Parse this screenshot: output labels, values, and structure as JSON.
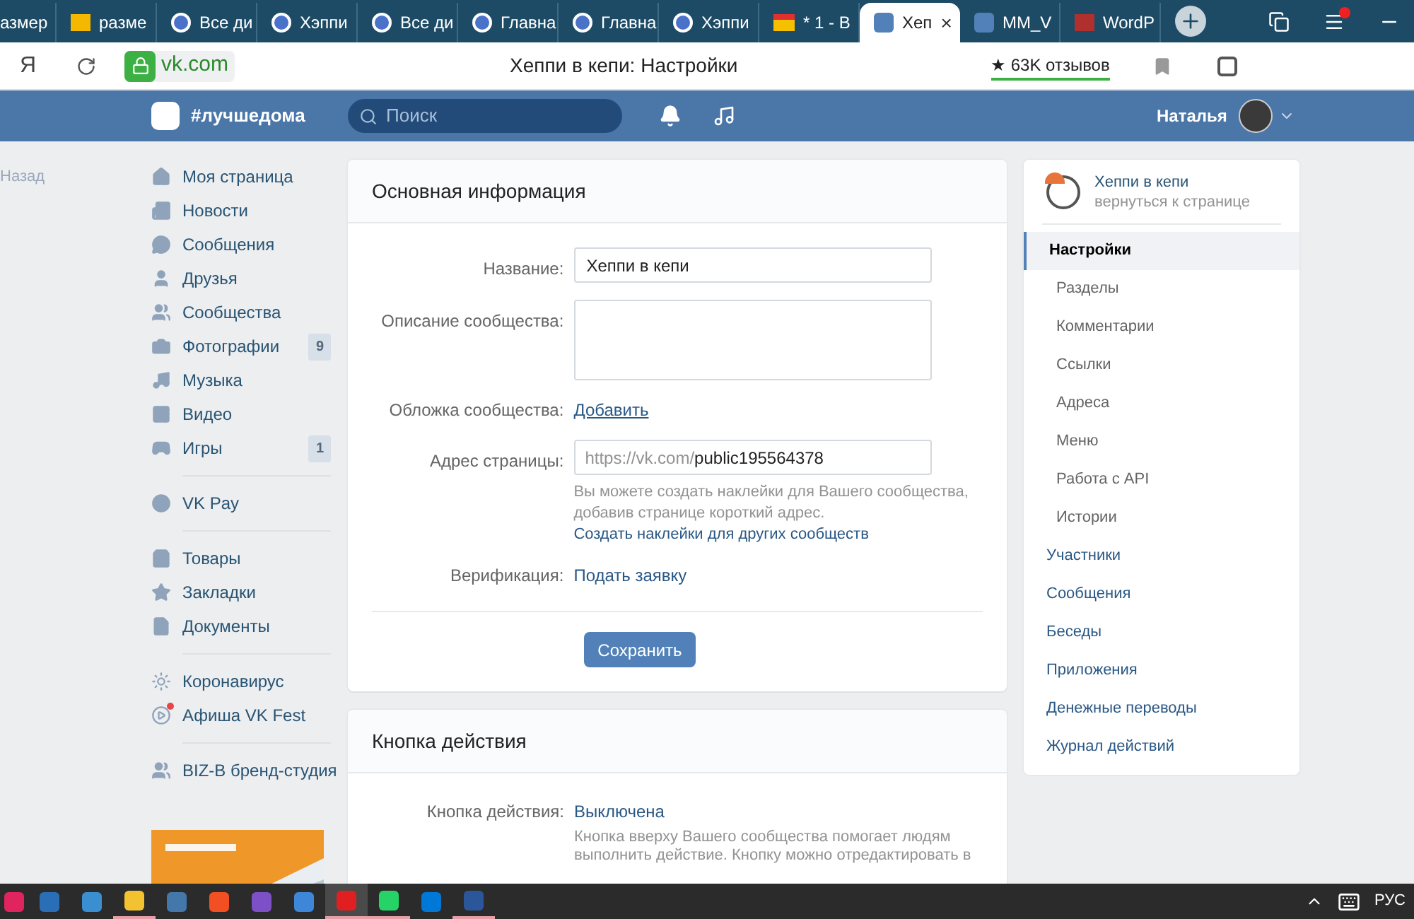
{
  "browser": {
    "tabs": [
      {
        "label": "азмер",
        "selected": false
      },
      {
        "label": "разме",
        "selected": false
      },
      {
        "label": "Все ди",
        "selected": false
      },
      {
        "label": "Хэппи",
        "selected": false
      },
      {
        "label": "Все ди",
        "selected": false
      },
      {
        "label": "Главна",
        "selected": false
      },
      {
        "label": "Главна",
        "selected": false
      },
      {
        "label": "Хэппи",
        "selected": false
      },
      {
        "label": "* 1 - В",
        "selected": false
      },
      {
        "label": "Хеп",
        "selected": true
      },
      {
        "label": "MM_V",
        "selected": false
      },
      {
        "label": "WordP",
        "selected": false
      }
    ],
    "close_tab": "×",
    "browser_logo": "Я",
    "domain": "vk.com",
    "page_title": "Хеппи в кепи: Настройки",
    "reviews": "★ 63K отзывов"
  },
  "header": {
    "hashtag": "#лучшедома",
    "search": {
      "placeholder": "Поиск"
    },
    "user_name": "Наталья"
  },
  "back": "Назад",
  "left_menu": [
    [
      {
        "label": "Моя страница"
      },
      {
        "label": "Новости"
      },
      {
        "label": "Сообщения"
      },
      {
        "label": "Друзья"
      },
      {
        "label": "Сообщества"
      },
      {
        "label": "Фотографии",
        "badge": "9"
      },
      {
        "label": "Музыка"
      },
      {
        "label": "Видео"
      },
      {
        "label": "Игры",
        "badge": "1"
      }
    ],
    [
      {
        "label": "VK Pay"
      }
    ],
    [
      {
        "label": "Товары"
      },
      {
        "label": "Закладки"
      },
      {
        "label": "Документы"
      }
    ],
    [
      {
        "label": "Коронавирус",
        "notify": false
      },
      {
        "label": "Афиша VK Fest",
        "notify": true
      }
    ],
    [
      {
        "label": "BIZ-B бренд-студия"
      }
    ]
  ],
  "main_card": {
    "title": "Основная информация",
    "rows": [
      {
        "kind": "input",
        "label": "Название:",
        "value": "Хеппи в кепи"
      },
      {
        "kind": "textarea",
        "label": "Описание сообщества:"
      },
      {
        "kind": "link",
        "label": "Обложка сообщества:",
        "value": "Добавить"
      },
      {
        "kind": "address",
        "label": "Адрес страницы:",
        "prefix": "https://vk.com/",
        "value": "public195564378",
        "hint": "Вы можете создать наклейки для Вашего сообщества, добавив странице короткий адрес.",
        "hint_link": "Создать наклейки для других сообществ"
      },
      {
        "kind": "text",
        "label": "Верификация:",
        "value": "Подать заявку"
      }
    ],
    "save": "Сохранить"
  },
  "action_card": {
    "title": "Кнопка действия",
    "label": "Кнопка действия:",
    "value": "Выключена",
    "hint": "Кнопка вверху Вашего сообщества помогает людям выполнить действие. Кнопку можно отредактировать в"
  },
  "right_menu": {
    "group_name": "Хеппи в кепи",
    "group_link": "вернуться к странице",
    "items": [
      {
        "label": "Настройки",
        "selected": true,
        "children": [
          {
            "label": "Разделы",
            "selected": false
          },
          {
            "label": "Комментарии",
            "selected": false
          },
          {
            "label": "Ссылки",
            "selected": false
          },
          {
            "label": "Адреса",
            "selected": false
          },
          {
            "label": "Меню",
            "selected": false
          },
          {
            "label": "Работа с API",
            "selected": false
          },
          {
            "label": "Истории",
            "selected": false
          }
        ]
      },
      {
        "label": "Участники",
        "selected": false
      },
      {
        "label": "Сообщения",
        "selected": false
      },
      {
        "label": "Беседы",
        "selected": false
      },
      {
        "label": "Приложения",
        "selected": false
      },
      {
        "label": "Денежные переводы",
        "selected": false
      },
      {
        "label": "Журнал действий",
        "selected": false
      }
    ]
  },
  "taskbar": {
    "apps": [
      {
        "selected": false,
        "running": false
      },
      {
        "selected": false,
        "running": false
      },
      {
        "selected": false,
        "running": false
      },
      {
        "selected": false,
        "running": true
      },
      {
        "selected": false,
        "running": false
      },
      {
        "selected": false,
        "running": false
      },
      {
        "selected": false,
        "running": false
      },
      {
        "selected": false,
        "running": false
      },
      {
        "selected": true,
        "running": true
      },
      {
        "selected": false,
        "running": true
      },
      {
        "selected": false,
        "running": false
      },
      {
        "selected": false,
        "running": true
      }
    ],
    "language": "РУС"
  }
}
